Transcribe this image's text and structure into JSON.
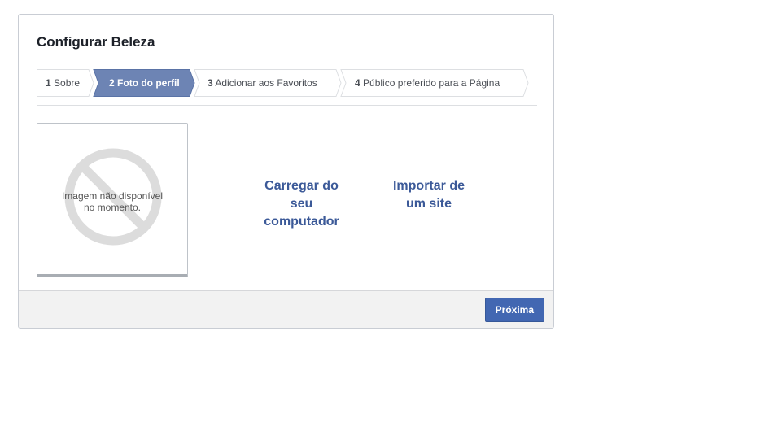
{
  "dialog": {
    "title": "Configurar Beleza"
  },
  "steps": [
    {
      "number": "1",
      "label": "Sobre",
      "active": false
    },
    {
      "number": "2",
      "label": "Foto do perfil",
      "active": true
    },
    {
      "number": "3",
      "label": "Adicionar aos Favoritos",
      "active": false
    },
    {
      "number": "4",
      "label": "Público preferido para a Página",
      "active": false
    }
  ],
  "photo": {
    "line1": "Imagem não disponível",
    "line2": "no momento."
  },
  "actions": {
    "upload": {
      "line1": "Carregar do",
      "line2": "seu",
      "line3": "computador"
    },
    "import": {
      "line1": "Importar de",
      "line2": "um site"
    }
  },
  "footer": {
    "next_label": "Próxima"
  },
  "colors": {
    "accent": "#4267b2",
    "active_step": "#6d84b4",
    "link": "#3b5998"
  }
}
